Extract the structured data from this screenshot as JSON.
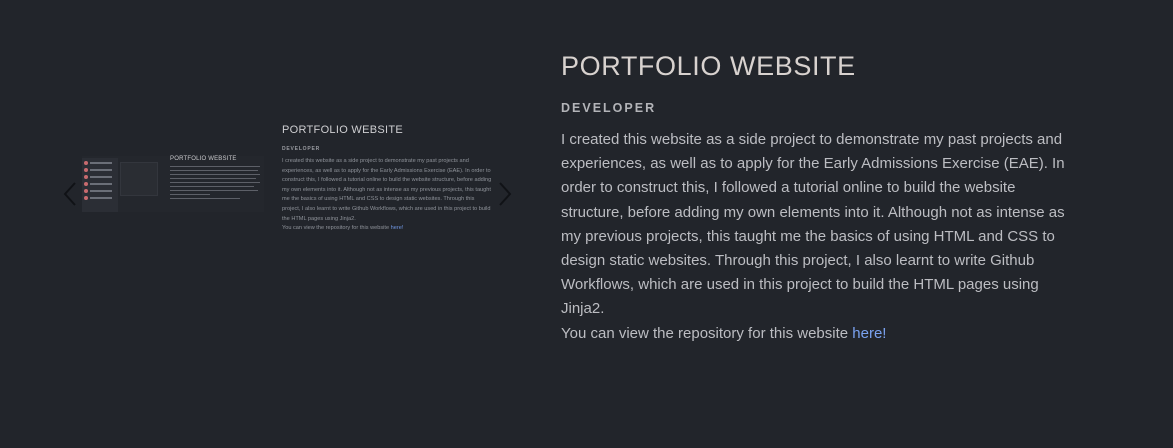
{
  "project": {
    "title": "PORTFOLIO WEBSITE",
    "role": "DEVELOPER",
    "description": "I created this website as a side project to demonstrate my past projects and experiences, as well as to apply for the Early Admissions Exercise (EAE). In order to construct this, I followed a tutorial online to build the website structure, before adding my own elements into it. Although not as intense as my previous projects, this taught me the basics of using HTML and CSS to design static websites. Through this project, I also learnt to write Github Workflows, which are used in this project to build the HTML pages using Jinja2.",
    "repo_prefix": "You can view the repository for this website ",
    "repo_link": "here!"
  },
  "carousel": {
    "prev_icon": "chevron-left-icon",
    "next_icon": "chevron-right-icon",
    "slide": {
      "title": "PORTFOLIO WEBSITE",
      "role": "DEVELOPER",
      "description": "I created this website as a side project to demonstrate my past projects and experiences, as well as to apply for the Early Admissions Exercise (EAE). In order to construct this, I followed a tutorial online to build the website structure, before adding my own elements into it. Although not as intense as my previous projects, this taught me the basics of using HTML and CSS to design static websites. Through this project, I also learnt to write Github Workflows, which are used in this project to build the HTML pages using Jinja2.",
      "repo_prefix": "You can view the repository for this website ",
      "repo_link": "here!",
      "mini_title": "PORTFOLIO WEBSITE"
    }
  },
  "colors": {
    "background": "#22252b",
    "title": "#d8d2cf",
    "body_text": "#bcbdc2",
    "link": "#7aa2f0",
    "accent_dot": "#c86b6f"
  }
}
